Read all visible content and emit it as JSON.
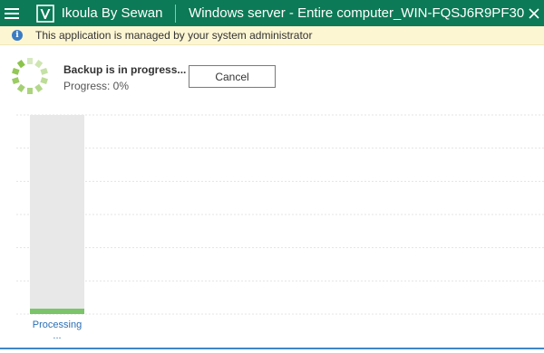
{
  "titlebar": {
    "menu_icon": "hamburger-menu-icon",
    "logo_icon": "veeam-v-logo-icon",
    "app_name": "Ikoula By Sewan",
    "window_title": "Windows server - Entire computer_WIN-FQSJ6R9PF30",
    "close_icon": "close-icon",
    "background": "#0c7a56"
  },
  "banner": {
    "icon": "info-icon",
    "text": "This application is managed by your system administrator",
    "background": "#fdf6d3"
  },
  "progress": {
    "title": "Backup is in progress...",
    "status": "Progress: 0%",
    "percent": 0,
    "cancel_label": "Cancel",
    "spinner_icon": "spinner-icon",
    "spinner_color": "#8bc34a"
  },
  "chart_data": {
    "type": "bar",
    "categories": [
      "Processing ..."
    ],
    "series": [
      {
        "values": [
          0
        ]
      }
    ],
    "ylim": [
      0,
      100
    ],
    "grid": true,
    "bar_color": "#7cc46a",
    "track_color": "#e8e8e8"
  }
}
